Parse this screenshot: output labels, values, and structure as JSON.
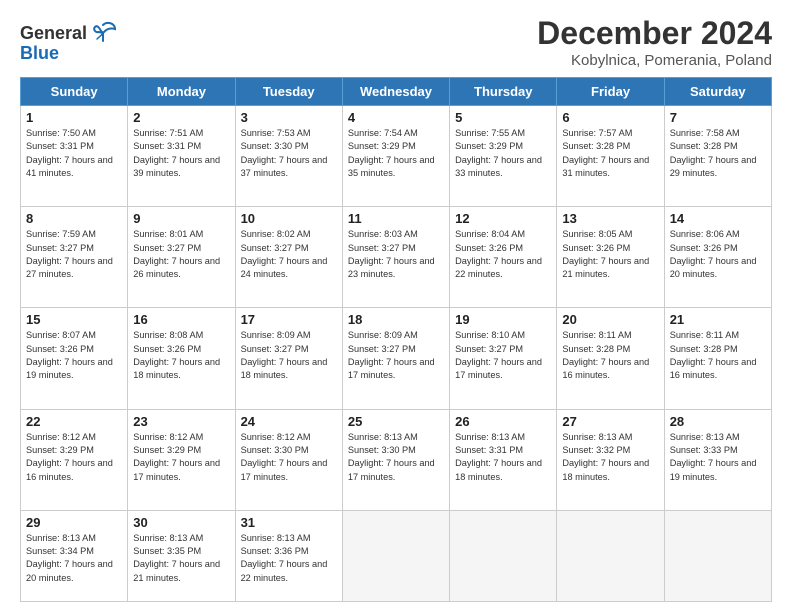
{
  "header": {
    "logo_line1": "General",
    "logo_line2": "Blue",
    "title": "December 2024",
    "subtitle": "Kobylnica, Pomerania, Poland"
  },
  "weekdays": [
    "Sunday",
    "Monday",
    "Tuesday",
    "Wednesday",
    "Thursday",
    "Friday",
    "Saturday"
  ],
  "weeks": [
    [
      {
        "day": "1",
        "sunrise": "7:50 AM",
        "sunset": "3:31 PM",
        "daylight": "7 hours and 41 minutes."
      },
      {
        "day": "2",
        "sunrise": "7:51 AM",
        "sunset": "3:31 PM",
        "daylight": "7 hours and 39 minutes."
      },
      {
        "day": "3",
        "sunrise": "7:53 AM",
        "sunset": "3:30 PM",
        "daylight": "7 hours and 37 minutes."
      },
      {
        "day": "4",
        "sunrise": "7:54 AM",
        "sunset": "3:29 PM",
        "daylight": "7 hours and 35 minutes."
      },
      {
        "day": "5",
        "sunrise": "7:55 AM",
        "sunset": "3:29 PM",
        "daylight": "7 hours and 33 minutes."
      },
      {
        "day": "6",
        "sunrise": "7:57 AM",
        "sunset": "3:28 PM",
        "daylight": "7 hours and 31 minutes."
      },
      {
        "day": "7",
        "sunrise": "7:58 AM",
        "sunset": "3:28 PM",
        "daylight": "7 hours and 29 minutes."
      }
    ],
    [
      {
        "day": "8",
        "sunrise": "7:59 AM",
        "sunset": "3:27 PM",
        "daylight": "7 hours and 27 minutes."
      },
      {
        "day": "9",
        "sunrise": "8:01 AM",
        "sunset": "3:27 PM",
        "daylight": "7 hours and 26 minutes."
      },
      {
        "day": "10",
        "sunrise": "8:02 AM",
        "sunset": "3:27 PM",
        "daylight": "7 hours and 24 minutes."
      },
      {
        "day": "11",
        "sunrise": "8:03 AM",
        "sunset": "3:27 PM",
        "daylight": "7 hours and 23 minutes."
      },
      {
        "day": "12",
        "sunrise": "8:04 AM",
        "sunset": "3:26 PM",
        "daylight": "7 hours and 22 minutes."
      },
      {
        "day": "13",
        "sunrise": "8:05 AM",
        "sunset": "3:26 PM",
        "daylight": "7 hours and 21 minutes."
      },
      {
        "day": "14",
        "sunrise": "8:06 AM",
        "sunset": "3:26 PM",
        "daylight": "7 hours and 20 minutes."
      }
    ],
    [
      {
        "day": "15",
        "sunrise": "8:07 AM",
        "sunset": "3:26 PM",
        "daylight": "7 hours and 19 minutes."
      },
      {
        "day": "16",
        "sunrise": "8:08 AM",
        "sunset": "3:26 PM",
        "daylight": "7 hours and 18 minutes."
      },
      {
        "day": "17",
        "sunrise": "8:09 AM",
        "sunset": "3:27 PM",
        "daylight": "7 hours and 18 minutes."
      },
      {
        "day": "18",
        "sunrise": "8:09 AM",
        "sunset": "3:27 PM",
        "daylight": "7 hours and 17 minutes."
      },
      {
        "day": "19",
        "sunrise": "8:10 AM",
        "sunset": "3:27 PM",
        "daylight": "7 hours and 17 minutes."
      },
      {
        "day": "20",
        "sunrise": "8:11 AM",
        "sunset": "3:28 PM",
        "daylight": "7 hours and 16 minutes."
      },
      {
        "day": "21",
        "sunrise": "8:11 AM",
        "sunset": "3:28 PM",
        "daylight": "7 hours and 16 minutes."
      }
    ],
    [
      {
        "day": "22",
        "sunrise": "8:12 AM",
        "sunset": "3:29 PM",
        "daylight": "7 hours and 16 minutes."
      },
      {
        "day": "23",
        "sunrise": "8:12 AM",
        "sunset": "3:29 PM",
        "daylight": "7 hours and 17 minutes."
      },
      {
        "day": "24",
        "sunrise": "8:12 AM",
        "sunset": "3:30 PM",
        "daylight": "7 hours and 17 minutes."
      },
      {
        "day": "25",
        "sunrise": "8:13 AM",
        "sunset": "3:30 PM",
        "daylight": "7 hours and 17 minutes."
      },
      {
        "day": "26",
        "sunrise": "8:13 AM",
        "sunset": "3:31 PM",
        "daylight": "7 hours and 18 minutes."
      },
      {
        "day": "27",
        "sunrise": "8:13 AM",
        "sunset": "3:32 PM",
        "daylight": "7 hours and 18 minutes."
      },
      {
        "day": "28",
        "sunrise": "8:13 AM",
        "sunset": "3:33 PM",
        "daylight": "7 hours and 19 minutes."
      }
    ],
    [
      {
        "day": "29",
        "sunrise": "8:13 AM",
        "sunset": "3:34 PM",
        "daylight": "7 hours and 20 minutes."
      },
      {
        "day": "30",
        "sunrise": "8:13 AM",
        "sunset": "3:35 PM",
        "daylight": "7 hours and 21 minutes."
      },
      {
        "day": "31",
        "sunrise": "8:13 AM",
        "sunset": "3:36 PM",
        "daylight": "7 hours and 22 minutes."
      },
      null,
      null,
      null,
      null
    ]
  ]
}
